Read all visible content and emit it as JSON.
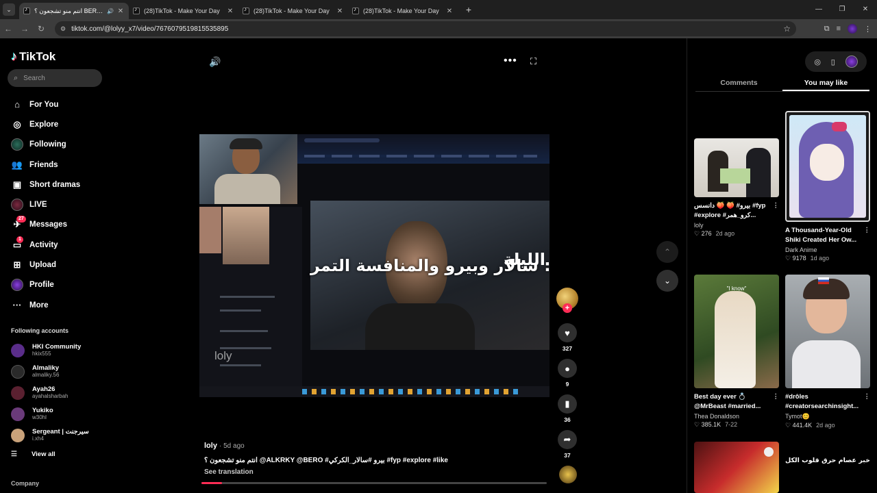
{
  "browser": {
    "tabs": [
      {
        "label": "انتم منو تشجعون ؟ BERO@",
        "active": true,
        "sound": true
      },
      {
        "label": "(28)TikTok - Make Your Day",
        "active": false,
        "sound": false
      },
      {
        "label": "(28)TikTok - Make Your Day",
        "active": false,
        "sound": false
      },
      {
        "label": "(28)TikTok - Make Your Day",
        "active": false,
        "sound": false
      }
    ],
    "url": "tiktok.com/@lolyy_x7/video/7676079519815535895"
  },
  "sidebar": {
    "brand": "TikTok",
    "search_placeholder": "Search",
    "nav": [
      {
        "label": "For You",
        "icon": "home-icon"
      },
      {
        "label": "Explore",
        "icon": "compass-icon"
      },
      {
        "label": "Following",
        "icon": "avatar-icon"
      },
      {
        "label": "Friends",
        "icon": "friends-icon"
      },
      {
        "label": "Short dramas",
        "icon": "drama-icon"
      },
      {
        "label": "LIVE",
        "icon": "live-icon"
      },
      {
        "label": "Messages",
        "icon": "messages-icon",
        "badge": "27"
      },
      {
        "label": "Activity",
        "icon": "activity-icon",
        "badge": "1"
      },
      {
        "label": "Upload",
        "icon": "upload-icon"
      },
      {
        "label": "Profile",
        "icon": "profile-icon"
      },
      {
        "label": "More",
        "icon": "more-icon"
      }
    ],
    "following_title": "Following accounts",
    "accounts": [
      {
        "name": "HKI Community",
        "handle": "hkix555",
        "color": "#5a2d8a"
      },
      {
        "name": "Almaliky",
        "handle": "almaliky.56",
        "color": "#2a2a2a"
      },
      {
        "name": "Ayah26",
        "handle": "ayahalsharbah",
        "color": "#5a2030"
      },
      {
        "name": "Yukiko",
        "handle": "w30hl",
        "color": "#6a3a7a"
      },
      {
        "name": "Sergeant | سيرجنت",
        "handle": "i.xh4",
        "color": "#c9a27a"
      }
    ],
    "view_all": "View all",
    "company": "Company"
  },
  "video": {
    "overlay_caption": "سالار وبيرو والمنافسة التمر :",
    "overlay_left_word": "الليلة",
    "watermark": "loly",
    "progress": 0.06
  },
  "actions": {
    "likes": "327",
    "comments": "9",
    "saves": "36",
    "shares": "37"
  },
  "post": {
    "username": "loly",
    "ago": "5d ago",
    "description": "انتم منو تشجعون ؟ @ALKRKY @BERO #بيرو #سالار_الكركي #fyp #explore #like",
    "see_translation": "See translation"
  },
  "right_panel": {
    "tabs": [
      "Comments",
      "You may like"
    ],
    "active_tab": 1,
    "cards": [
      {
        "title": "بيرو# 🍑 🍑 دانسس #fyp #explore #كرو_همر...",
        "author": "loly",
        "likes": "276",
        "when": "2d ago"
      },
      {
        "title": "A Thousand-Year-Old Shiki Created Her Ow...",
        "author": "Dark Anime",
        "likes": "9178",
        "when": "1d ago"
      },
      {
        "title": "Best day ever 💍 @MrBeast #married...",
        "author": "Thea Donaldson",
        "likes": "385.1K",
        "when": "7-22",
        "image_caption": "\"I know\""
      },
      {
        "title": "#drôles #creatorsearchinsight...",
        "author": "Tymot😊",
        "likes": "441.4K",
        "when": "2d ago"
      },
      {
        "title": "",
        "author": "",
        "likes": "",
        "when": ""
      },
      {
        "title": "",
        "author": "",
        "likes": "",
        "when": "",
        "image_text": "خبر عصام حرق قلوب الكل"
      }
    ]
  }
}
